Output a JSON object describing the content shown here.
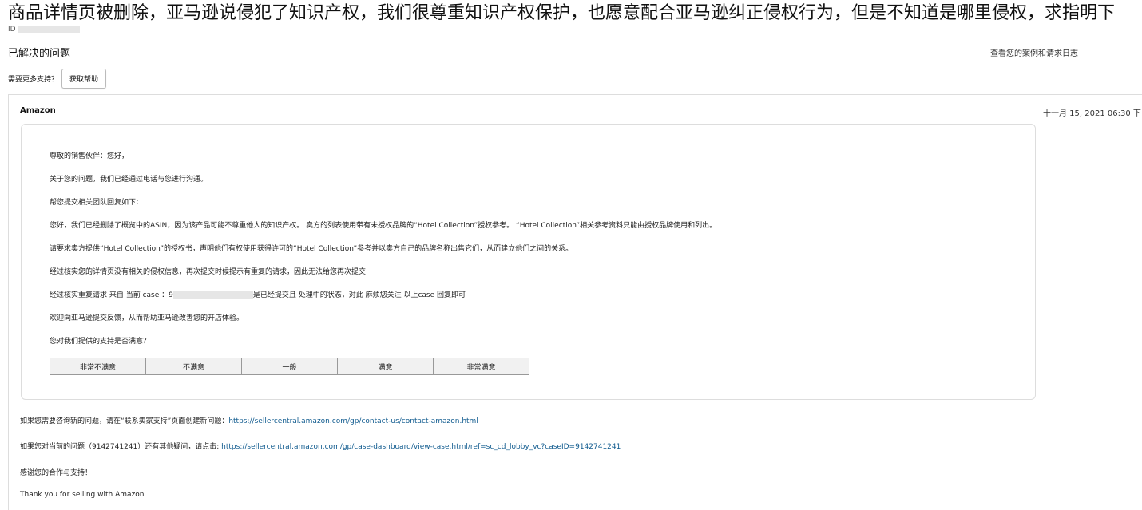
{
  "header": {
    "title": "商品详情页被删除，亚马逊说侵犯了知识产权，我们很尊重知识产权保护，也愿意配合亚马逊纠正侵权行为，但是不知道是哪里侵权，求指明下",
    "id_prefix": "ID",
    "status": "已解决的问题",
    "case_log_link": "查看您的案例和请求日志",
    "support_question": "需要更多支持？",
    "help_button": "获取帮助"
  },
  "message": {
    "sender": "Amazon",
    "timestamp": "十一月 15, 2021 06:30 下",
    "paragraphs": [
      "尊敬的销售伙伴：您好，",
      "关于您的问题，我们已经通过电话与您进行沟通。",
      "帮您提交相关团队回复如下：",
      "您好，我们已经删除了概览中的ASIN，因为该产品可能不尊重他人的知识产权。 卖方的列表使用带有未授权品牌的“Hotel Collection”授权参考。 “Hotel Collection”相关参考资料只能由授权品牌使用和列出。",
      "请要求卖方提供“Hotel Collection”的授权书，声明他们有权使用获得许可的“Hotel Collection”参考并以卖方自己的品牌名称出售它们，从而建立他们之间的关系。",
      "经过核实您的详情页没有相关的侵权信息，再次提交时候提示有重复的请求，因此无法给您再次提交"
    ],
    "dup_prefix": "经过核实重复请求 来自 当前 case ：9",
    "dup_suffix": "是已经提交且 处理中的状态，对此 麻烦您关注 以上case 回复即可",
    "feedback": "欢迎向亚马逊提交反馈，从而帮助亚马逊改善您的开店体验。",
    "satisfaction_question": "您对我们提供的支持是否满意？",
    "ratings": [
      "非常不满意",
      "不满意",
      "一般",
      "满意",
      "非常满意"
    ],
    "new_issue_text": "如果您需要咨询新的问题，请在“联系卖家支持”页面创建新问题：",
    "new_issue_link": "https://sellercentral.amazon.com/gp/contact-us/contact-amazon.html",
    "current_issue_text": "如果您对当前的问题（9142741241）还有其他疑问，请点击: ",
    "current_issue_link": "https://sellercentral.amazon.com/gp/case-dashboard/view-case.html/ref=sc_cd_lobby_vc?caseID=9142741241",
    "thanks": "感谢您的合作与支持！",
    "signoff": "Thank you for selling with Amazon"
  }
}
